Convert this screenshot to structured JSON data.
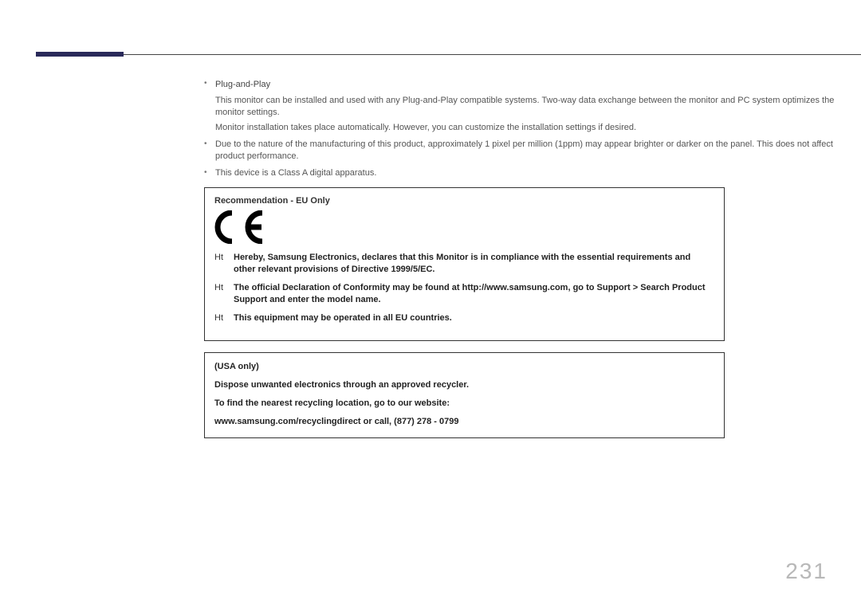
{
  "bullets": {
    "b1": {
      "title": "Plug-and-Play",
      "p1": "This monitor can be installed and used with any Plug-and-Play compatible systems. Two-way data exchange between the monitor and PC system optimizes the monitor settings.",
      "p2": "Monitor installation takes place automatically. However, you can customize the installation settings if desired."
    },
    "b2": {
      "text": "Due to the nature of the manufacturing of this product, approximately 1 pixel per million (1ppm) may appear brighter or darker on the panel. This does not affect product performance."
    },
    "b3": {
      "text": "This device is a Class A digital apparatus."
    }
  },
  "euBox": {
    "title": "Recommendation - EU Only",
    "items": {
      "i1": "Hereby, Samsung Electronics, declares that this Monitor is in compliance with the essential requirements and other relevant provisions of Directive 1999/5/EC.",
      "i2": "The official Declaration of Conformity may be found at http://www.samsung.com, go to Support > Search Product Support and enter the model name.",
      "i3": "This equipment may be operated in all EU countries."
    },
    "marker": "Ht"
  },
  "usaBox": {
    "p1": "(USA only)",
    "p2": "Dispose unwanted electronics through an approved recycler.",
    "p3": "To find the nearest recycling location, go to our website:",
    "p4": "www.samsung.com/recyclingdirect or call, (877) 278 - 0799"
  },
  "pageNumber": "231"
}
